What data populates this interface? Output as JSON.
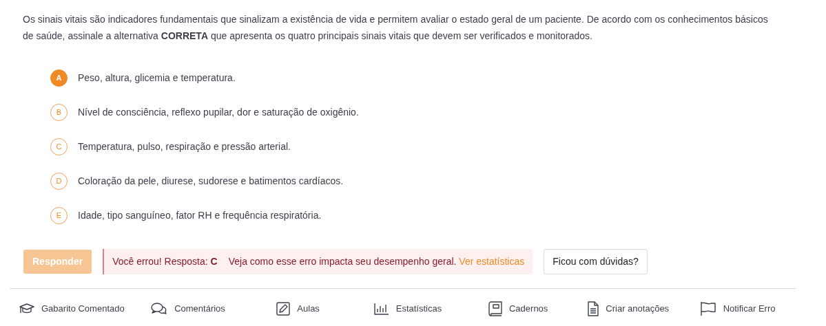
{
  "question": "Os sinais vitais são indicadores fundamentais que sinalizam a existência de vida e permitem avaliar o estado geral de um paciente. De acordo com os conhecimentos básicos de saúde, assinale a alternativa **CORRETA** que apresenta os quatro principais sinais vitais que devem ser verificados e monitorados.",
  "options": [
    {
      "letter": "A",
      "text": "Peso, altura, glicemia e temperatura.",
      "selected": true
    },
    {
      "letter": "B",
      "text": "Nível de consciência, reflexo pupilar, dor e saturação de oxigênio.",
      "selected": false
    },
    {
      "letter": "C",
      "text": "Temperatura, pulso, respiração e pressão arterial.",
      "selected": false
    },
    {
      "letter": "D",
      "text": "Coloração da pele, diurese, sudorese e batimentos cardíacos.",
      "selected": false
    },
    {
      "letter": "E",
      "text": "Idade, tipo sanguíneo, fator RH e frequência respiratória.",
      "selected": false
    }
  ],
  "answer_button": {
    "label": "Responder",
    "disabled": true
  },
  "feedback": {
    "message": "Você errou! Resposta: **C**",
    "detail": "Veja como esse erro impacta seu desempenho geral.",
    "link": "Ver estatísticas"
  },
  "help_button": "Ficou com dúvidas?",
  "tools": [
    "Gabarito Comentado",
    "Comentários",
    "Aulas",
    "Estatísticas",
    "Cadernos",
    "Criar anotações",
    "Notificar Erro"
  ]
}
